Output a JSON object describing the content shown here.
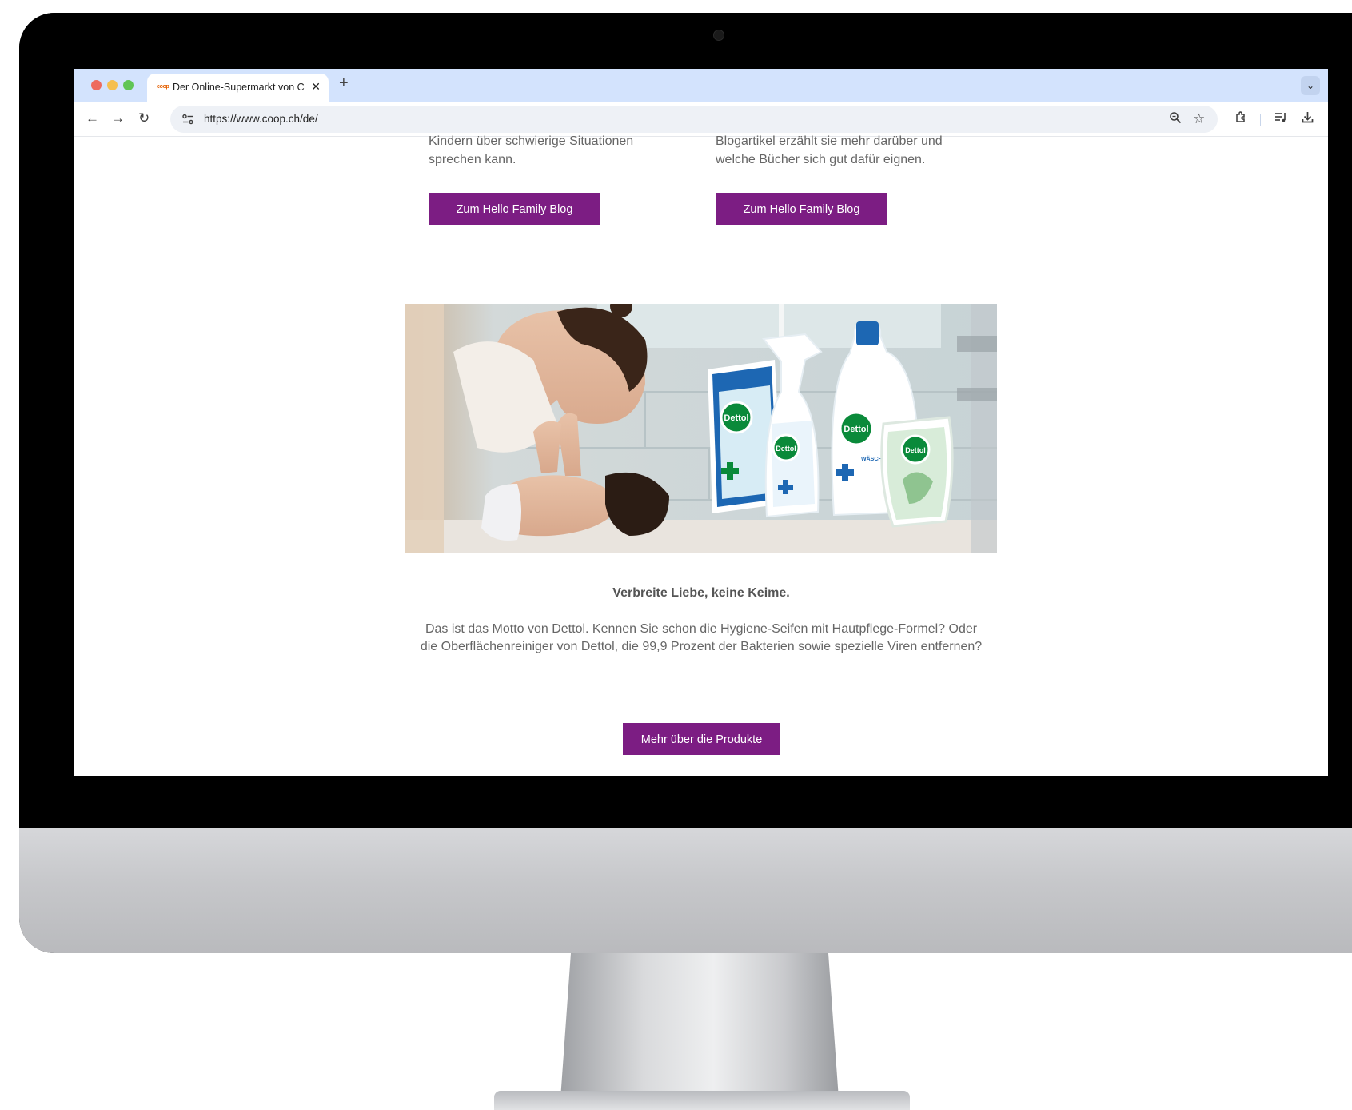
{
  "browser": {
    "tab": {
      "favicon_text": "coop",
      "title": "Der Online-Supermarkt von Coop",
      "close_glyph": "✕"
    },
    "new_tab_glyph": "+",
    "tab_menu_glyph": "⌄",
    "url": "https://www.coop.ch/de/",
    "icons": [
      "back-arrow-icon",
      "forward-arrow-icon",
      "reload-icon",
      "site-settings-icon",
      "zoom-icon",
      "bookmark-star-icon",
      "extensions-icon",
      "media-queue-icon",
      "download-icon"
    ]
  },
  "page": {
    "left_column": {
      "text": "Kindern über schwierige Situationen sprechen kann.",
      "button_label": "Zum Hello Family Blog"
    },
    "right_column": {
      "text": "Blogartikel erzählt sie mehr darüber und welche Bücher sich gut dafür eignen.",
      "button_label": "Zum Hello Family Blog"
    },
    "hero": {
      "brand_text": "Dettol",
      "bottle_labels": [
        "WÄSCHE-HYGIENE"
      ]
    },
    "headline": "Verbreite Liebe, keine Keime.",
    "paragraph": "Das ist das Motto von Dettol. Kennen Sie schon die Hygiene-Seifen mit Hautpflege-Formel? Oder die Oberflächenreiniger von Dettol, die 99,9 Prozent der Bakterien sowie spezielle Viren entfernen?",
    "cta_label": "Mehr über die Produkte"
  },
  "colors": {
    "brand_purple": "#7c1d83",
    "tabstrip": "#d3e3fd",
    "dettol_green": "#0a8a3a"
  }
}
